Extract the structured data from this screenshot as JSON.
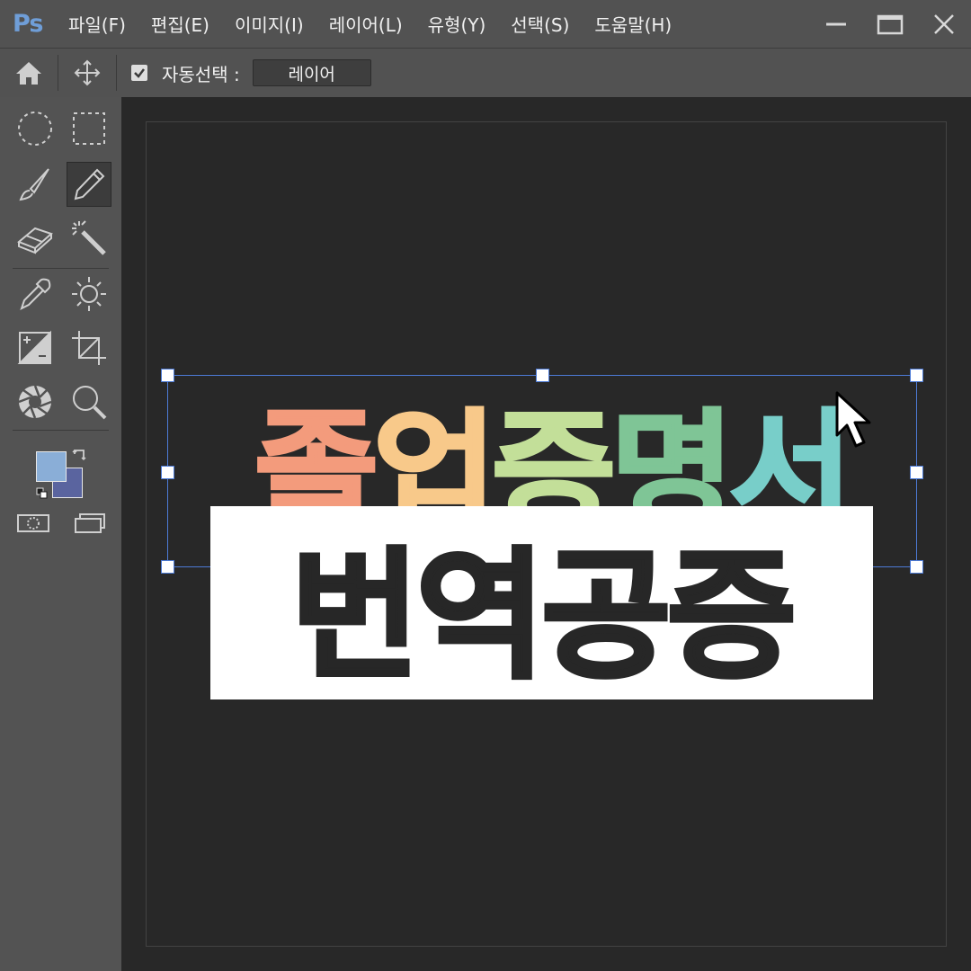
{
  "app": {
    "logo": "Ps"
  },
  "menubar": {
    "items": [
      {
        "label": "파일(F)"
      },
      {
        "label": "편집(E)"
      },
      {
        "label": "이미지(I)"
      },
      {
        "label": "레이어(L)"
      },
      {
        "label": "유형(Y)"
      },
      {
        "label": "선택(S)"
      },
      {
        "label": "도움말(H)"
      }
    ],
    "window_controls": [
      "minimize-icon",
      "maximize-icon",
      "close-icon"
    ]
  },
  "options": {
    "home_icon": "home-icon",
    "move_icon": "move-icon",
    "auto_select_checked": true,
    "auto_select_label": "자동선택 :",
    "target_value": "레이어"
  },
  "toolbar": {
    "tools": [
      "elliptical-marquee-icon",
      "rect-marquee-icon",
      "brush-icon",
      "pencil-icon",
      "eraser-icon",
      "magic-wand-icon",
      "eyedropper-icon",
      "brightness-icon",
      "adjust-icon",
      "crop-icon",
      "aperture-icon",
      "zoom-icon"
    ],
    "active_tool": "pencil-icon",
    "foreground_color": "#8aaed7",
    "background_color": "#5a649f"
  },
  "canvas": {
    "title_chars": [
      {
        "text": "졸",
        "color": "#f39b7c"
      },
      {
        "text": "업",
        "color": "#f8c98a"
      },
      {
        "text": "증",
        "color": "#c3df99"
      },
      {
        "text": "명",
        "color": "#7fc596"
      },
      {
        "text": "서",
        "color": "#78cec9"
      }
    ],
    "stamp_text": "번역공증",
    "selection_color": "#4d7bd6"
  }
}
